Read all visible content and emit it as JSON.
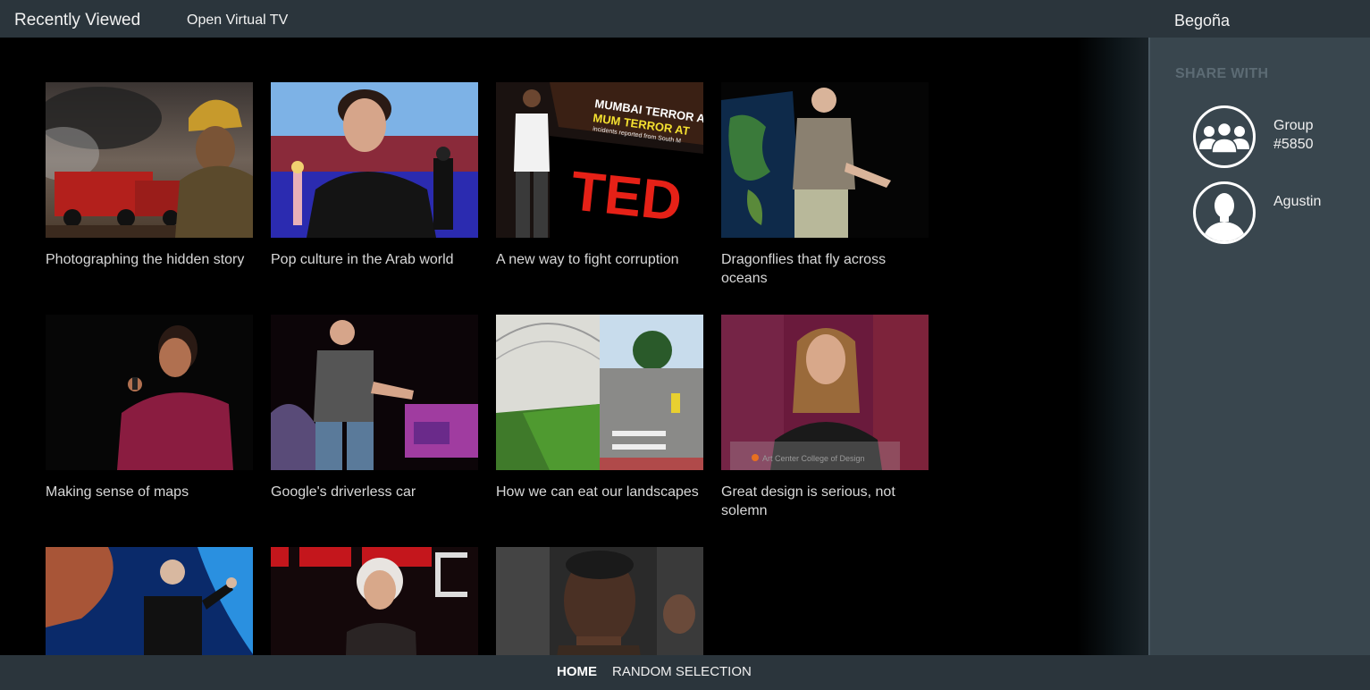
{
  "header": {
    "title": "Recently Viewed",
    "open_tv_link": "Open Virtual TV",
    "user_name": "Begoña"
  },
  "videos": [
    {
      "title": "Photographing the hidden story"
    },
    {
      "title": "Pop culture in the Arab world"
    },
    {
      "title": "A new way to fight corruption",
      "slide_text_1": "MUMBAI TERROR ATTA",
      "slide_text_2": "MUM TERROR AT",
      "slide_text_3": "incidents reported from South M",
      "logo_text": "TED"
    },
    {
      "title": "Dragonflies that fly across oceans"
    },
    {
      "title": "Making sense of maps"
    },
    {
      "title": "Google's driverless car"
    },
    {
      "title": "How we can eat our landscapes"
    },
    {
      "title": "Great design is serious, not solemn",
      "podium_text": "Art Center College of Design"
    },
    {
      "title": ""
    },
    {
      "title": ""
    },
    {
      "title": ""
    }
  ],
  "share_panel": {
    "title": "SHARE WITH",
    "contacts": [
      {
        "name": "Group #5850",
        "icon": "group-icon"
      },
      {
        "name": "Agustin",
        "icon": "person-icon"
      }
    ]
  },
  "footer": {
    "home": "HOME",
    "random": "RANDOM SELECTION"
  }
}
